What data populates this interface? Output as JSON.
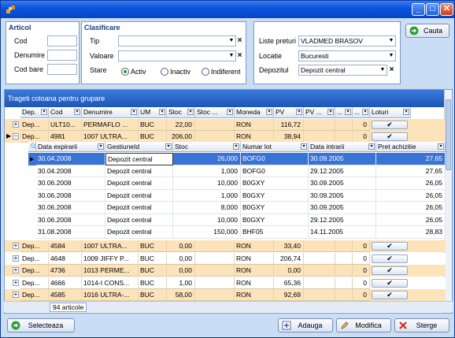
{
  "window": {
    "minimize": "_",
    "maximize": "□",
    "close": "✕"
  },
  "articol": {
    "title": "Articol",
    "cod": "Cod",
    "denumire": "Denumire",
    "cod_bare": "Cod bare"
  },
  "clasificare": {
    "title": "Clasificare",
    "tip": "Tip",
    "valoare": "Valoare",
    "stare": "Stare",
    "activ": "Activ",
    "inactiv": "Inactiv",
    "indiferent": "Indiferent"
  },
  "right": {
    "liste_preturi": "Liste preturi",
    "liste_preturi_value": "VLADMED BRASOV",
    "locatie": "Locatie",
    "locatie_value": "Bucuresti",
    "depozitul": "Depozitul",
    "depozitul_value": "Depozit central"
  },
  "cauta": "Cauta",
  "group_bar": "Trageti coloana pentru grupare",
  "headers": [
    "Dep.",
    "Cod",
    "Denumire",
    "UM",
    "Stoc",
    "Stoc ...",
    "Moneda",
    "PV",
    "PV ...",
    "...",
    "...",
    "Loturi"
  ],
  "rows_top": [
    {
      "dep": "Dep...",
      "cod": "ULT10...",
      "denumire": "PERMAFLO ...",
      "um": "BUC",
      "stoc": "22,00",
      "moneda": "RON",
      "pv": "116,72",
      "n": "0",
      "style": "orange"
    },
    {
      "dep": "Dep...",
      "cod": "4981",
      "denumire": "1007 ULTRA...",
      "um": "BUC",
      "stoc": "206,00",
      "moneda": "RON",
      "pv": "38,94",
      "n": "0",
      "style": "sel"
    }
  ],
  "detail_headers": [
    "Data  expirarii",
    "GestiuneId",
    "Stoc",
    "Numar lot",
    "Data intrarii",
    "Pret achizitie"
  ],
  "detail_rows": [
    {
      "data": "30.04.2008",
      "gest": "Depozit central",
      "stoc": "26,000",
      "lot": "BOFG0",
      "intrare": "30.09.2005",
      "pret": "27,65"
    },
    {
      "data": "30.04.2008",
      "gest": "Depozit central",
      "stoc": "1,000",
      "lot": "BOFG0",
      "intrare": "29.12.2005",
      "pret": "27,65"
    },
    {
      "data": "30.06.2008",
      "gest": "Depozit central",
      "stoc": "10,000",
      "lot": "B0GXY",
      "intrare": "30.09.2005",
      "pret": "26,05"
    },
    {
      "data": "30.06.2008",
      "gest": "Depozit central",
      "stoc": "1,000",
      "lot": "B0GXY",
      "intrare": "30.09.2005",
      "pret": "26,05"
    },
    {
      "data": "30.06.2008",
      "gest": "Depozit central",
      "stoc": "8,000",
      "lot": "B0GXY",
      "intrare": "30.09.2005",
      "pret": "26,05"
    },
    {
      "data": "30.06.2008",
      "gest": "Depozit central",
      "stoc": "10,000",
      "lot": "B0GXY",
      "intrare": "29.12.2005",
      "pret": "26,05"
    },
    {
      "data": "31.08.2008",
      "gest": "Depozit central",
      "stoc": "150,000",
      "lot": "BHF05",
      "intrare": "14.11.2005",
      "pret": "28,83"
    }
  ],
  "rows_bottom": [
    {
      "dep": "Dep...",
      "cod": "4584",
      "denumire": "1007 ULTRA...",
      "um": "BUC",
      "stoc": "0,00",
      "moneda": "RON",
      "pv": "33,40",
      "n": "0",
      "style": "orange"
    },
    {
      "dep": "Dep...",
      "cod": "4648",
      "denumire": "1009 JIFFY P...",
      "um": "BUC",
      "stoc": "0,00",
      "moneda": "RON",
      "pv": "206,74",
      "n": "0",
      "style": "white"
    },
    {
      "dep": "Dep...",
      "cod": "4736",
      "denumire": "1013 PERME...",
      "um": "BUC",
      "stoc": "0,00",
      "moneda": "RON",
      "pv": "0,00",
      "n": "0",
      "style": "orange"
    },
    {
      "dep": "Dep...",
      "cod": "4666",
      "denumire": "1014-I CONS...",
      "um": "BUC",
      "stoc": "1,00",
      "moneda": "RON",
      "pv": "65,36",
      "n": "0",
      "style": "white"
    },
    {
      "dep": "Dep...",
      "cod": "4585",
      "denumire": "1016 ULTRA-...",
      "um": "BUC",
      "stoc": "58,00",
      "moneda": "RON",
      "pv": "92,69",
      "n": "0",
      "style": "orange"
    }
  ],
  "footer_count": "94 articole",
  "buttons": {
    "selecteaza": "Selecteaza",
    "adauga": "Adauga",
    "modifica": "Modifica",
    "sterge": "Sterge"
  }
}
